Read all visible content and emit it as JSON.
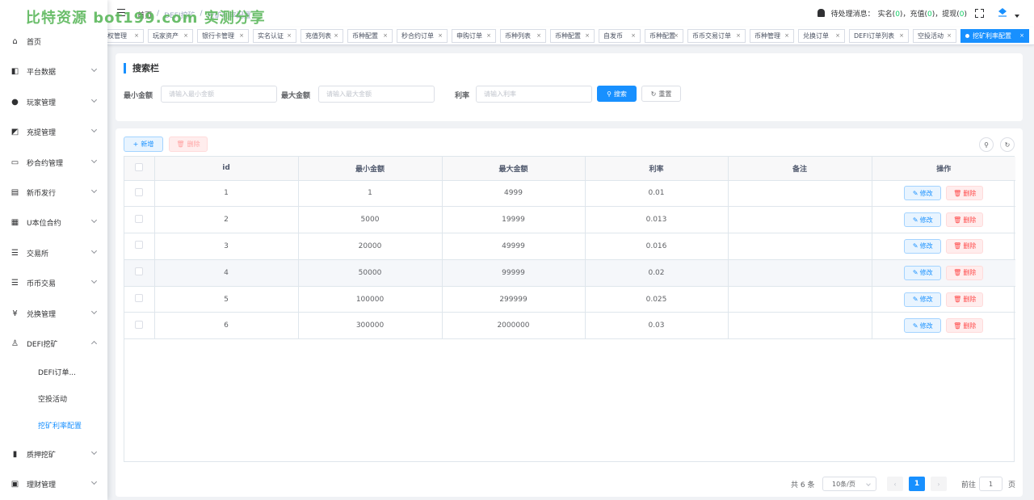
{
  "watermark": "比特资源 bot199.com 实测分享",
  "sidebar": {
    "items": [
      {
        "label": "首页",
        "icon": "home-icon",
        "glyph": "⌂",
        "has_arrow": false
      },
      {
        "label": "平台数据",
        "icon": "data-icon",
        "glyph": "◧",
        "has_arrow": true
      },
      {
        "label": "玩家管理",
        "icon": "user-icon",
        "glyph": "●",
        "has_arrow": true
      },
      {
        "label": "充提管理",
        "icon": "copy-icon",
        "glyph": "◩",
        "has_arrow": true
      },
      {
        "label": "秒合约管理",
        "icon": "monitor-icon",
        "glyph": "▭",
        "has_arrow": true
      },
      {
        "label": "新币发行",
        "icon": "card-icon",
        "glyph": "▤",
        "has_arrow": true
      },
      {
        "label": "U本位合约",
        "icon": "grid-icon",
        "glyph": "▦",
        "has_arrow": true
      },
      {
        "label": "交易所",
        "icon": "list-icon",
        "glyph": "☰",
        "has_arrow": true
      },
      {
        "label": "币币交易",
        "icon": "list-icon",
        "glyph": "☰",
        "has_arrow": true
      },
      {
        "label": "兑换管理",
        "icon": "yen-icon",
        "glyph": "¥",
        "has_arrow": true
      },
      {
        "label": "DEFI挖矿",
        "icon": "person-icon",
        "glyph": "♙",
        "has_arrow": true,
        "expanded": true
      }
    ],
    "sub_items": [
      {
        "label": "DEFI订单...",
        "active": false
      },
      {
        "label": "空投活动",
        "active": false
      },
      {
        "label": "挖矿利率配置",
        "active": true
      }
    ],
    "bottom_items": [
      {
        "label": "质押挖矿",
        "icon": "chart-icon",
        "glyph": "▮",
        "has_arrow": true
      },
      {
        "label": "理财管理",
        "icon": "save-icon",
        "glyph": "▣",
        "has_arrow": true
      }
    ]
  },
  "header": {
    "breadcrumb": [
      "首页",
      "/",
      "DEFI挖矿",
      "/",
      "挖矿利率配置"
    ],
    "notice_label": "待处理消息：",
    "notice_parts": [
      {
        "text": "实名",
        "count": "0"
      },
      {
        "text": "充值",
        "count": "0"
      },
      {
        "text": "提现",
        "count": "0"
      }
    ]
  },
  "tags": [
    {
      "label": "权管理",
      "active": false
    },
    {
      "label": "玩家资产",
      "active": false
    },
    {
      "label": "银行卡管理",
      "active": false
    },
    {
      "label": "实名认证",
      "active": false
    },
    {
      "label": "充值列表",
      "active": false
    },
    {
      "label": "币种配置",
      "active": false
    },
    {
      "label": "秒合约订单",
      "active": false
    },
    {
      "label": "申购订单",
      "active": false
    },
    {
      "label": "币种列表",
      "active": false
    },
    {
      "label": "币种配置",
      "active": false
    },
    {
      "label": "自发币",
      "active": false
    },
    {
      "label": "币种配置",
      "active": false
    },
    {
      "label": "币币交易订单",
      "active": false
    },
    {
      "label": "币种管理",
      "active": false
    },
    {
      "label": "兑换订单",
      "active": false
    },
    {
      "label": "DEFI订单列表",
      "active": false
    },
    {
      "label": "空投活动",
      "active": false
    },
    {
      "label": "挖矿利率配置",
      "active": true
    }
  ],
  "search": {
    "title": "搜索栏",
    "fields": [
      {
        "label": "最小金额",
        "placeholder": "请输入最小金额"
      },
      {
        "label": "最大金额",
        "placeholder": "请输入最大金额"
      },
      {
        "label": "利率",
        "placeholder": "请输入利率"
      }
    ],
    "search_label": "搜索",
    "reset_label": "重置"
  },
  "toolbar": {
    "add_label": "新增",
    "delete_label": "删除"
  },
  "table": {
    "columns": [
      "id",
      "最小金额",
      "最大金额",
      "利率",
      "备注",
      "操作"
    ],
    "rows": [
      {
        "id": "1",
        "min": "1",
        "max": "4999",
        "rate": "0.01",
        "note": ""
      },
      {
        "id": "2",
        "min": "5000",
        "max": "19999",
        "rate": "0.013",
        "note": ""
      },
      {
        "id": "3",
        "min": "20000",
        "max": "49999",
        "rate": "0.016",
        "note": ""
      },
      {
        "id": "4",
        "min": "50000",
        "max": "99999",
        "rate": "0.02",
        "note": ""
      },
      {
        "id": "5",
        "min": "100000",
        "max": "299999",
        "rate": "0.025",
        "note": ""
      },
      {
        "id": "6",
        "min": "300000",
        "max": "2000000",
        "rate": "0.03",
        "note": ""
      }
    ],
    "edit_label": "修改",
    "delete_label": "删除",
    "hover_row": 3
  },
  "pagination": {
    "total": "共 6 条",
    "page_size": "10条/页",
    "current": "1",
    "goto_label": "前往",
    "goto_value": "1",
    "page_suffix": "页"
  },
  "colors": {
    "primary": "#1890ff",
    "danger": "#ff4949",
    "success": "#13ce66"
  }
}
